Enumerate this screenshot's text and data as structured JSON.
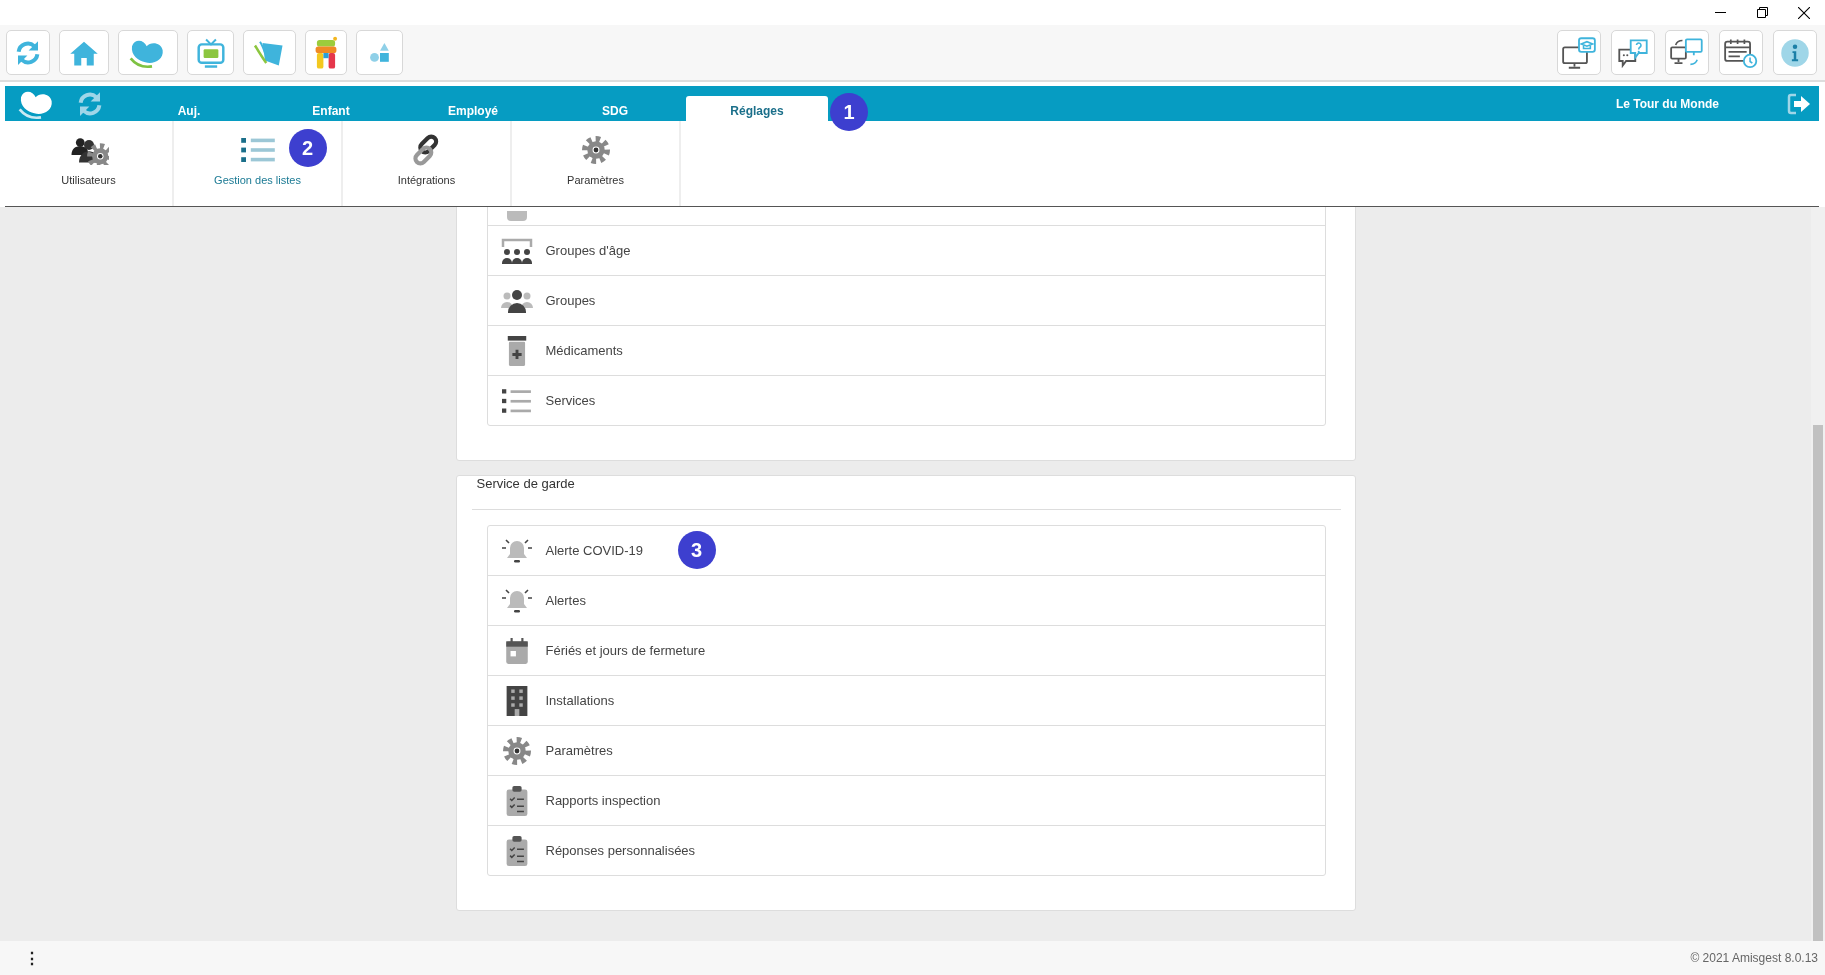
{
  "nav": {
    "tabs": [
      {
        "label": "Auj.",
        "selected": false
      },
      {
        "label": "Enfant",
        "selected": false
      },
      {
        "label": "Employé",
        "selected": false
      },
      {
        "label": "SDG",
        "selected": false
      },
      {
        "label": "Réglages",
        "selected": true,
        "callout": "1"
      }
    ],
    "site": "Le Tour du Monde"
  },
  "settings_menu": {
    "items": [
      {
        "kind": "users",
        "label": "Utilisateurs",
        "selected": false
      },
      {
        "kind": "lists",
        "label": "Gestion des listes",
        "selected": true,
        "callout": "2"
      },
      {
        "kind": "integrations",
        "label": "Intégrations",
        "selected": false
      },
      {
        "kind": "settings",
        "label": "Paramètres",
        "selected": false
      }
    ]
  },
  "sections": [
    {
      "rows": [
        {
          "kind": "partial"
        },
        {
          "kind": "age-groups",
          "label": "Groupes d'âge"
        },
        {
          "kind": "groups",
          "label": "Groupes"
        },
        {
          "kind": "medication",
          "label": "Médicaments"
        },
        {
          "kind": "list",
          "label": "Services"
        }
      ]
    },
    {
      "title": "Service de garde",
      "rows": [
        {
          "kind": "alert",
          "label": "Alerte COVID-19",
          "callout": "3"
        },
        {
          "kind": "alert",
          "label": "Alertes"
        },
        {
          "kind": "calendar",
          "label": "Fériés et jours de fermeture"
        },
        {
          "kind": "building",
          "label": "Installations"
        },
        {
          "kind": "settings",
          "label": "Paramètres"
        },
        {
          "kind": "clipboard",
          "label": "Rapports inspection"
        },
        {
          "kind": "clipboard",
          "label": "Réponses personnalisées"
        }
      ]
    }
  ],
  "footer": {
    "menu": "⋮",
    "copyright": "© 2021 Amisgest 8.0.13"
  }
}
